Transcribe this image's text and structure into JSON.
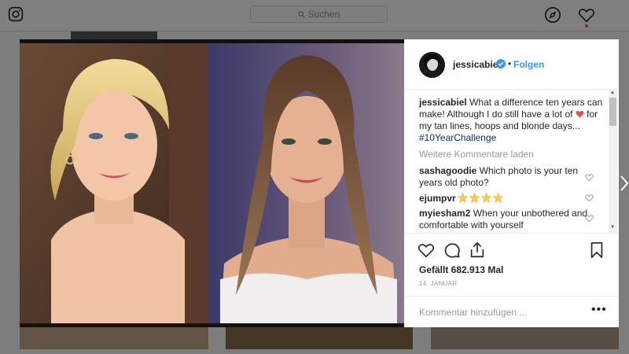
{
  "topbar": {
    "search_placeholder": "Suchen",
    "icons": [
      "instagram-logo-icon",
      "search-icon",
      "compass-icon",
      "heart-icon"
    ]
  },
  "post": {
    "author": "jessicabiel",
    "follow_label": "Folgen",
    "separator": "•",
    "caption": {
      "user": "jessicabiel",
      "text_before_heart": "What a difference ten years can make! Although I do still have a lot of",
      "text_after_heart": "for my tan lines, hoops and blonde days...",
      "hashtag": "#10YearChallenge"
    },
    "load_more_label": "Weitere Kommentare laden",
    "comments": [
      {
        "user": "sashagoodie",
        "text": "Which photo is your ten years old photo?"
      },
      {
        "user": "ejumpvr",
        "stars": 4
      },
      {
        "user": "myiesham2",
        "text": "When your unbothered and comfortable with yourself"
      }
    ],
    "likes": "Gefällt 682.913 Mal",
    "date": "14. JANUAR",
    "add_comment_placeholder": "Kommentar hinzufügen ...",
    "more_label": "•••"
  },
  "colors": {
    "link_blue": "#3897f0",
    "verified_blue": "#3897f0",
    "heart_red": "#ed4956",
    "star_yellow": "#ffcc4d"
  }
}
